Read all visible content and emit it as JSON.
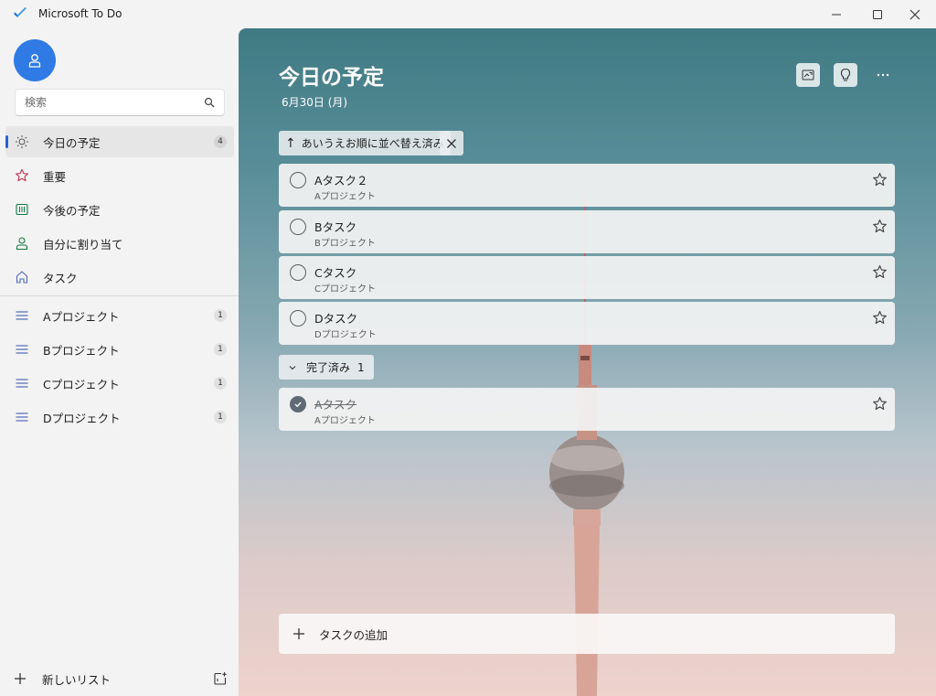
{
  "window": {
    "title": "Microsoft To Do"
  },
  "sidebar": {
    "search_placeholder": "検索",
    "items": [
      {
        "label": "今日の予定",
        "icon": "sun-icon",
        "count": "4",
        "active": true
      },
      {
        "label": "重要",
        "icon": "star-icon",
        "count": ""
      },
      {
        "label": "今後の予定",
        "icon": "calendar-icon",
        "count": ""
      },
      {
        "label": "自分に割り当て",
        "icon": "person-icon",
        "count": ""
      },
      {
        "label": "タスク",
        "icon": "home-icon",
        "count": ""
      }
    ],
    "lists": [
      {
        "label": "Aプロジェクト",
        "icon": "list-icon",
        "count": "1"
      },
      {
        "label": "Bプロジェクト",
        "icon": "list-icon",
        "count": "1"
      },
      {
        "label": "Cプロジェクト",
        "icon": "list-icon",
        "count": "1"
      },
      {
        "label": "Dプロジェクト",
        "icon": "list-icon",
        "count": "1"
      }
    ],
    "new_list_label": "新しいリスト"
  },
  "main": {
    "title": "今日の予定",
    "date": "6月30日 (月)",
    "sort_label": "あいうえお順に並べ替え済み",
    "tasks": [
      {
        "title": "Aタスク２",
        "project": "Aプロジェクト"
      },
      {
        "title": "Bタスク",
        "project": "Bプロジェクト"
      },
      {
        "title": "Cタスク",
        "project": "Cプロジェクト"
      },
      {
        "title": "Dタスク",
        "project": "Dプロジェクト"
      }
    ],
    "completed_label": "完了済み",
    "completed_count": "1",
    "completed_tasks": [
      {
        "title": "Aタスク",
        "project": "Aプロジェクト"
      }
    ],
    "add_task_label": "タスクの追加"
  },
  "colors": {
    "accent": "#2564cf",
    "avatar": "#2f7ae5",
    "star": "#c4314b",
    "green": "#107c41"
  }
}
